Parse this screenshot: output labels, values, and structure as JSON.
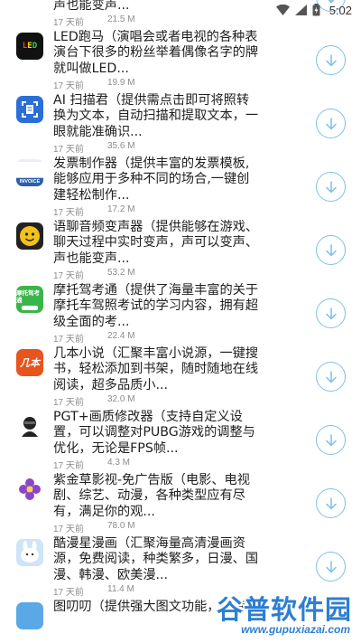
{
  "status_bar": {
    "time": "5:02",
    "icons": [
      "wifi-icon",
      "signal-icon",
      "battery-icon"
    ]
  },
  "apps": [
    {
      "icon": "voice-changer-icon",
      "icon_color": "#8a4fd8",
      "desc": "语聊音频变声器（提供能够在游戏、聊天过程中实时变声，声可以变声、声也能变声...",
      "date": "17 天前",
      "size": "21.5 M"
    },
    {
      "icon": "led-marquee-icon",
      "icon_color": "#111111",
      "icon_text": "LED",
      "desc": "LED跑马（演唱会或者电视的各种表演台下很多的粉丝举着偶像名字的牌就叫做LED...",
      "date": "17 天前",
      "size": "19.9 M"
    },
    {
      "icon": "ai-scanner-icon",
      "icon_color": "#2a6fd6",
      "desc": "AI 扫描君（提供需点击即可将照转换为文本，自动扫描和提取文本，一眼就能准确识...",
      "date": "17 天前",
      "size": "35.6 M"
    },
    {
      "icon": "invoice-icon",
      "icon_color": "#2b5fae",
      "icon_text": "INVOICE",
      "desc": "发票制作器（提供丰富的发票模板,能够应用于多种不同的场合,一键创建轻松制作...",
      "date": "17 天前",
      "size": "17.2 M"
    },
    {
      "icon": "voice-face-icon",
      "icon_color": "#f3c21a",
      "desc": "语聊音频变声器（提供能够在游戏、聊天过程中实时变声，声可以变声、声也能变声...",
      "date": "17 天前",
      "size": "53.2 M"
    },
    {
      "icon": "moto-exam-icon",
      "icon_color": "#39b54a",
      "icon_text": "摩托驾考通",
      "desc": "摩托驾考通（提供了海量丰富的关于摩托车驾照考试的学习内容，拥有超级全面的考...",
      "date": "17 天前",
      "size": "22.4 M"
    },
    {
      "icon": "novel-icon",
      "icon_color": "#e8541e",
      "icon_text": "几本",
      "desc": "几本小说（汇聚丰富小说源，一键搜书，轻松添加到书架，随时随地在线阅读，超多品质小...",
      "date": "17 天前",
      "size": "32.0 M"
    },
    {
      "icon": "pgt-icon",
      "icon_color": "#ffffff",
      "desc": "PGT+画质修改器（支持自定义设置，可以调整对PUBG游戏的调整与优化，无论是FPS帧...",
      "date": "17 天前",
      "size": "4.3 M"
    },
    {
      "icon": "flower-icon",
      "icon_color": "#8e44c8",
      "desc": "紫金草影视-免广告版（电影、电视剧、综艺、动漫，各种类型应有尽有，满足你的观...",
      "date": "17 天前",
      "size": "78.0 M"
    },
    {
      "icon": "manga-icon",
      "icon_color": "#b9d8f5",
      "desc": "酷漫星漫画（汇聚海量高清漫画资源，免费阅读，种类繁多，日漫、国漫、韩漫、欧美漫...",
      "date": "17 天前",
      "size": "11.4 M"
    },
    {
      "icon": "partial-icon",
      "icon_color": "#5aa8e6",
      "desc": "图叨叨（提供强大图文功能，支持...",
      "date": "17 天前",
      "size": ""
    }
  ],
  "watermark": {
    "title": "谷普软件园",
    "url": "www.gupuxiazai.com"
  }
}
